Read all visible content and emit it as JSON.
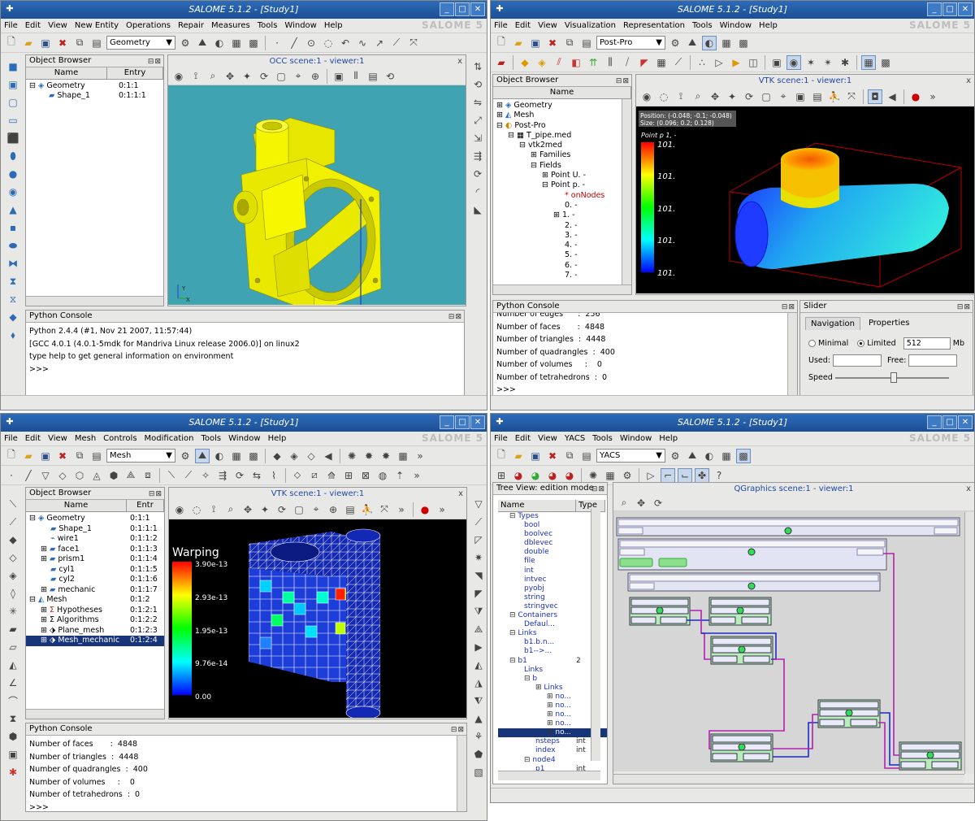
{
  "colors": {
    "title_bar": "#1c4f95",
    "viewer_bg_occ": "#3fa3b1",
    "viewer_bg_vtk": "#000000",
    "selection": "#19357a",
    "shape_yellow": "#f2f200"
  },
  "q1": {
    "title": "SALOME 5.1.2 - [Study1]",
    "menu": [
      "File",
      "Edit",
      "View",
      "New Entity",
      "Operations",
      "Repair",
      "Measures",
      "Tools",
      "Window",
      "Help"
    ],
    "module": "Geometry",
    "logo": "SALOME 5",
    "browser_title": "Object Browser",
    "col_name": "Name",
    "col_entry": "Entry",
    "tree": [
      {
        "n": "Geometry",
        "e": "0:1:1"
      },
      {
        "n": "Shape_1",
        "e": "0:1:1:1"
      }
    ],
    "viewer_title": "OCC scene:1 - viewer:1",
    "console_title": "Python Console",
    "console": [
      "Python 2.4.4 (#1, Nov 21 2007, 11:57:44)",
      "[GCC 4.0.1 (4.0.1-5mdk for Mandriva Linux release 2006.0)] on linux2",
      "type help to get general information on environment",
      ">>>"
    ]
  },
  "q2": {
    "title": "SALOME 5.1.2 - [Study1]",
    "menu": [
      "File",
      "Edit",
      "View",
      "Visualization",
      "Representation",
      "Tools",
      "Window",
      "Help"
    ],
    "module": "Post-Pro",
    "logo": "SALOME 5",
    "browser_title": "Object Browser",
    "col_name": "Name",
    "tree": [
      "Geometry",
      "Mesh",
      "Post-Pro",
      "T_pipe.med",
      "vtk2med",
      "Families",
      "Fields",
      "Point U. -",
      "Point p. -",
      "onNodes",
      "0. -",
      "1. -",
      "2. -",
      "3. -",
      "4. -",
      "5. -",
      "6. -",
      "7. -"
    ],
    "viewer_title": "VTK scene:1 - viewer:1",
    "position": "Position: (-0.048; -0.1; -0.048)",
    "size": "Size: (0.096; 0.2; 0.128)",
    "scalar_title": "Point p 1, -",
    "scalar_labels": [
      "101.",
      "101.",
      "101.",
      "101.",
      "101."
    ],
    "console_title": "Python Console",
    "console": [
      "Number of edges      :  256",
      "Number of faces       :  4848",
      "Number of triangles  :  4448",
      "Number of quadrangles  :  400",
      "Number of volumes     :    0",
      "Number of tetrahedrons  :  0",
      ">>>"
    ],
    "slider_title": "Slider",
    "tab_nav": "Navigation",
    "tab_props": "Properties",
    "radio_min": "Minimal",
    "radio_lim": "Limited",
    "limit_value": "512",
    "unit": "Mb",
    "used": "Used:",
    "free": "Free:",
    "speed": "Speed"
  },
  "q3": {
    "title": "SALOME 5.1.2 - [Study1]",
    "menu": [
      "File",
      "Edit",
      "View",
      "Mesh",
      "Controls",
      "Modification",
      "Tools",
      "Window",
      "Help"
    ],
    "module": "Mesh",
    "logo": "SALOME 5",
    "browser_title": "Object Browser",
    "col_name": "Name",
    "col_entry": "Entr",
    "tree": [
      {
        "n": "Geometry",
        "e": "0:1:1"
      },
      {
        "n": "Shape_1",
        "e": "0:1:1:1"
      },
      {
        "n": "wire1",
        "e": "0:1:1:2"
      },
      {
        "n": "face1",
        "e": "0:1:1:3"
      },
      {
        "n": "prism1",
        "e": "0:1:1:4"
      },
      {
        "n": "cyl1",
        "e": "0:1:1:5"
      },
      {
        "n": "cyl2",
        "e": "0:1:1:6"
      },
      {
        "n": "mechanic",
        "e": "0:1:1:7"
      },
      {
        "n": "Mesh",
        "e": "0:1:2"
      },
      {
        "n": "Hypotheses",
        "e": "0:1:2:1"
      },
      {
        "n": "Algorithms",
        "e": "0:1:2:2"
      },
      {
        "n": "Plane_mesh",
        "e": "0:1:2:3"
      },
      {
        "n": "Mesh_mechanic",
        "e": "0:1:2:4"
      }
    ],
    "viewer_title": "VTK scene:1 - viewer:1",
    "scalar_title": "Warping",
    "scalar_labels": [
      "3.90e-13",
      "2.93e-13",
      "1.95e-13",
      "9.76e-14",
      "0.00"
    ],
    "console_title": "Python Console",
    "console": [
      "Number of faces       :  4848",
      "Number of triangles  :  4448",
      "Number of quadrangles  :  400",
      "Number of volumes     :    0",
      "Number of tetrahedrons  :  0",
      ">>>"
    ]
  },
  "q4": {
    "title": "SALOME 5.1.2 - [Study1]",
    "menu": [
      "File",
      "Edit",
      "View",
      "YACS",
      "Tools",
      "Window",
      "Help"
    ],
    "module": "YACS",
    "logo": "SALOME 5",
    "tree_title": "Tree View: edition mode",
    "col_name": "Name",
    "col_type": "Type",
    "tree": [
      {
        "n": "Types",
        "t": ""
      },
      {
        "n": "bool",
        "t": ""
      },
      {
        "n": "boolvec",
        "t": ""
      },
      {
        "n": "dblevec",
        "t": ""
      },
      {
        "n": "double",
        "t": ""
      },
      {
        "n": "file",
        "t": ""
      },
      {
        "n": "int",
        "t": ""
      },
      {
        "n": "intvec",
        "t": ""
      },
      {
        "n": "pyobj",
        "t": ""
      },
      {
        "n": "string",
        "t": ""
      },
      {
        "n": "stringvec",
        "t": ""
      },
      {
        "n": "Containers",
        "t": ""
      },
      {
        "n": "Defaul...",
        "t": ""
      },
      {
        "n": "Links",
        "t": ""
      },
      {
        "n": "b1.b.n...",
        "t": ""
      },
      {
        "n": "b1-->...",
        "t": ""
      },
      {
        "n": "b1",
        "t": "2"
      },
      {
        "n": "Links",
        "t": ""
      },
      {
        "n": "b",
        "t": ""
      },
      {
        "n": "Links",
        "t": ""
      },
      {
        "n": "no...",
        "t": ""
      },
      {
        "n": "no...",
        "t": ""
      },
      {
        "n": "no...",
        "t": ""
      },
      {
        "n": "no...",
        "t": ""
      },
      {
        "n": "no...",
        "t": ""
      },
      {
        "n": "nsteps",
        "t": "int"
      },
      {
        "n": "index",
        "t": "int"
      },
      {
        "n": "node4",
        "t": ""
      },
      {
        "n": "p1",
        "t": "int"
      }
    ],
    "viewer_title": "QGraphics scene:1 - viewer:1"
  }
}
